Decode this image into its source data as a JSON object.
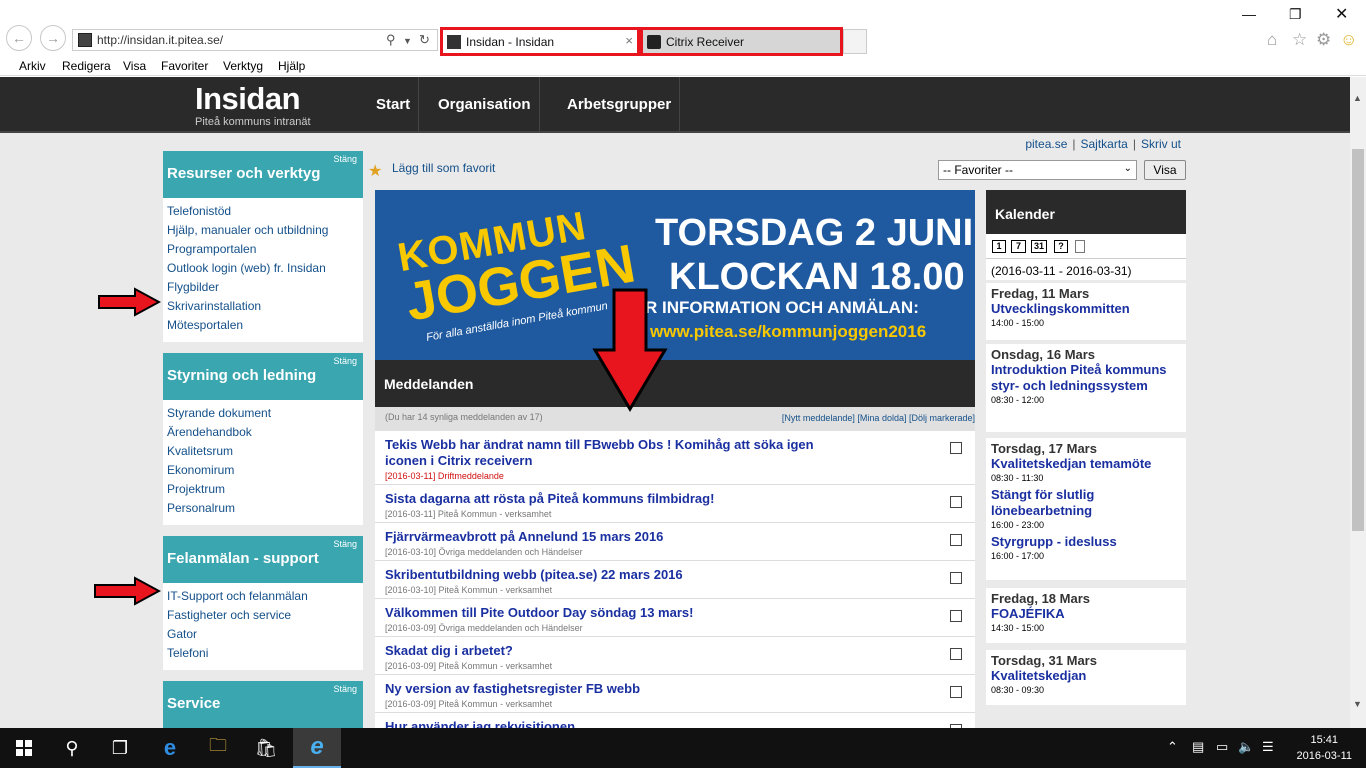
{
  "browser": {
    "url": "http://insidan.it.pitea.se/",
    "tabs": [
      {
        "label": "Insidan - Insidan",
        "active": true
      },
      {
        "label": "Citrix Receiver",
        "active": false
      }
    ],
    "menu": [
      "Arkiv",
      "Redigera",
      "Visa",
      "Favoriter",
      "Verktyg",
      "Hjälp"
    ]
  },
  "header": {
    "logo": "Insidan",
    "logo_sub": "Piteå kommuns intranät",
    "nav": [
      "Start",
      "Organisation",
      "Arbetsgrupper"
    ]
  },
  "toplinks": [
    "pitea.se",
    "Sajtkarta",
    "Skriv ut"
  ],
  "favorites": {
    "add_label": "Lägg till som favorit",
    "select_value": "-- Favoriter --",
    "button": "Visa"
  },
  "sidebar": {
    "close_label": "Stäng",
    "boxes": [
      {
        "title": "Resurser och verktyg",
        "items": [
          "Telefonistöd",
          "Hjälp, manualer och utbildning",
          "Programportalen",
          "Outlook login (web) fr. Insidan",
          "Flygbilder",
          "Skrivarinstallation",
          "Mötesportalen"
        ]
      },
      {
        "title": "Styrning och ledning",
        "items": [
          "Styrande dokument",
          "Ärendehandbok",
          "Kvalitetsrum",
          "Ekonomirum",
          "Projektrum",
          "Personalrum"
        ]
      },
      {
        "title": "Felanmälan - support",
        "items": [
          "IT-Support och felanmälan",
          "Fastigheter och service",
          "Gator",
          "Telefoni"
        ]
      },
      {
        "title": "Service",
        "items": []
      }
    ]
  },
  "banner": {
    "word1": "KOMMUN",
    "word2": "JOGGEN",
    "sub": "För alla anställda inom Piteå kommun",
    "line1": "TORSDAG 2 JUNI",
    "line2": "KLOCKAN 18.00",
    "line3": "R INFORMATION OCH ANMÄLAN:",
    "line4": "www.pitea.se/kommunjoggen2016"
  },
  "messages": {
    "heading": "Meddelanden",
    "count_text": "(Du har 14 synliga meddelanden av 17)",
    "actions": "[Nytt meddelande] [Mina dolda] [Dölj markerade]",
    "items": [
      {
        "title": "Tekis Webb har ändrat namn till FBwebb Obs ! Komihåg att söka igen iconen i Citrix receivern",
        "meta": "[2016-03-11] Driftmeddelande",
        "red": true
      },
      {
        "title": "Sista dagarna att rösta på Piteå kommuns filmbidrag!",
        "meta": "[2016-03-11] Piteå Kommun - verksamhet",
        "red": false
      },
      {
        "title": "Fjärrvärmeavbrott på Annelund 15 mars 2016",
        "meta": "[2016-03-10] Övriga meddelanden och Händelser",
        "red": false
      },
      {
        "title": "Skribentutbildning webb (pitea.se) 22 mars 2016",
        "meta": "[2016-03-10] Piteå Kommun - verksamhet",
        "red": false
      },
      {
        "title": "Välkommen till Pite Outdoor Day söndag 13 mars!",
        "meta": "[2016-03-09] Övriga meddelanden och Händelser",
        "red": false
      },
      {
        "title": "Skadat dig i arbetet?",
        "meta": "[2016-03-09] Piteå Kommun - verksamhet",
        "red": false
      },
      {
        "title": "Ny version av fastighetsregister FB webb",
        "meta": "[2016-03-09] Piteå Kommun - verksamhet",
        "red": false
      },
      {
        "title": "Hur använder jag rekvisitionen",
        "meta": "",
        "red": false
      }
    ]
  },
  "calendar": {
    "heading": "Kalender",
    "views": [
      "1",
      "7",
      "31",
      "?"
    ],
    "range": "(2016-03-11 - 2016-03-31)",
    "days": [
      {
        "day": "Fredag, 11 Mars",
        "events": [
          {
            "title": "Utvecklingskommitten",
            "time": "14:00 - 15:00"
          }
        ]
      },
      {
        "day": "Onsdag, 16 Mars",
        "events": [
          {
            "title": "Introduktion Piteå kommuns styr- och ledningssystem",
            "time": "08:30 - 12:00"
          }
        ]
      },
      {
        "day": "Torsdag, 17 Mars",
        "events": [
          {
            "title": "Kvalitetskedjan temamöte",
            "time": "08:30 - 11:30"
          },
          {
            "title": "Stängt för slutlig lönebearbetning",
            "time": "16:00 - 23:00"
          },
          {
            "title": "Styrgrupp - idesluss",
            "time": "16:00 - 17:00"
          }
        ]
      },
      {
        "day": "Fredag, 18 Mars",
        "events": [
          {
            "title": "FOAJÉFIKA",
            "time": "14:30 - 15:00"
          }
        ]
      },
      {
        "day": "Torsdag, 31 Mars",
        "events": [
          {
            "title": "Kvalitetskedjan",
            "time": "08:30 - 09:30"
          }
        ]
      }
    ]
  },
  "taskbar": {
    "time": "15:41",
    "date": "2016-03-11"
  },
  "colors": {
    "accent_teal": "#3aa6b0",
    "header_dark": "#2a2a2a",
    "link_blue": "#14508a",
    "title_blue": "#1a2fa0",
    "annotation_red": "#e8151e"
  }
}
